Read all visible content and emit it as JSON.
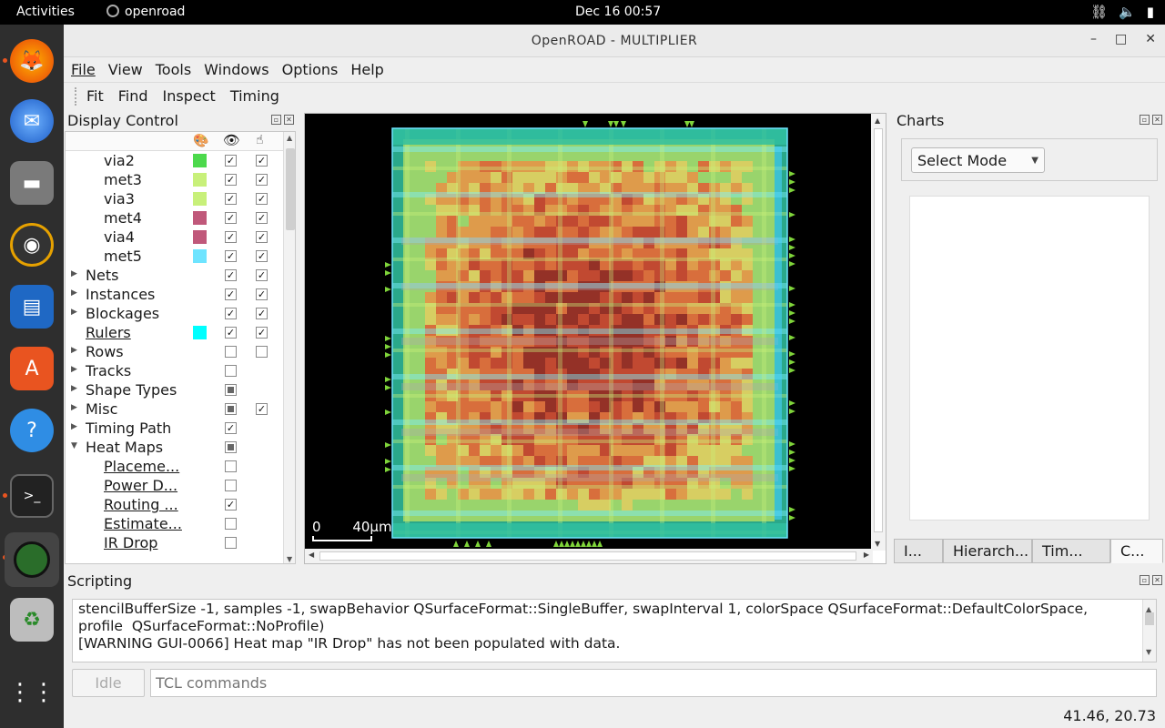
{
  "topbar": {
    "activities": "Activities",
    "app_name": "openroad",
    "clock": "Dec 16  00:57"
  },
  "window": {
    "title": "OpenROAD - MULTIPLIER",
    "minimize": "–",
    "maximize": "□",
    "close": "✕"
  },
  "menu": [
    "File",
    "View",
    "Tools",
    "Windows",
    "Options",
    "Help"
  ],
  "toolbar": [
    "Fit",
    "Find",
    "Inspect",
    "Timing"
  ],
  "display_control": {
    "title": "Display Control",
    "rows": [
      {
        "label": "via2",
        "indent": 2,
        "swatch": "#4cd94c",
        "vis": "checked",
        "sel": "checked"
      },
      {
        "label": "met3",
        "indent": 2,
        "swatch": "#c8f07a",
        "vis": "checked",
        "sel": "checked"
      },
      {
        "label": "via3",
        "indent": 2,
        "swatch": "#c8f07a",
        "vis": "checked",
        "sel": "checked"
      },
      {
        "label": "met4",
        "indent": 2,
        "swatch": "#c0587a",
        "vis": "checked",
        "sel": "checked"
      },
      {
        "label": "via4",
        "indent": 2,
        "swatch": "#c0587a",
        "vis": "checked",
        "sel": "checked"
      },
      {
        "label": "met5",
        "indent": 2,
        "swatch": "#6ee4ff",
        "vis": "checked",
        "sel": "checked"
      },
      {
        "label": "Nets",
        "indent": 1,
        "arrow": "right",
        "vis": "checked",
        "sel": "checked"
      },
      {
        "label": "Instances",
        "indent": 1,
        "arrow": "right",
        "vis": "checked",
        "sel": "checked"
      },
      {
        "label": "Blockages",
        "indent": 1,
        "arrow": "right",
        "vis": "checked",
        "sel": "checked"
      },
      {
        "label": "Rulers",
        "indent": 1,
        "link": true,
        "swatch": "#00ffff",
        "vis": "checked",
        "sel": "checked"
      },
      {
        "label": "Rows",
        "indent": 1,
        "arrow": "right",
        "vis": "empty",
        "sel": "empty"
      },
      {
        "label": "Tracks",
        "indent": 1,
        "arrow": "right",
        "vis": "empty"
      },
      {
        "label": "Shape Types",
        "indent": 1,
        "arrow": "right",
        "vis": "partial"
      },
      {
        "label": "Misc",
        "indent": 1,
        "arrow": "right",
        "vis": "partial",
        "sel": "checked"
      },
      {
        "label": "Timing Path",
        "indent": 1,
        "arrow": "right",
        "vis": "checked"
      },
      {
        "label": "Heat Maps",
        "indent": 1,
        "arrow": "down",
        "vis": "partial"
      },
      {
        "label": "Placeme...",
        "indent": 2,
        "link": true,
        "vis": "empty"
      },
      {
        "label": "Power D...",
        "indent": 2,
        "link": true,
        "vis": "empty"
      },
      {
        "label": "Routing ...",
        "indent": 2,
        "link": true,
        "vis": "checked"
      },
      {
        "label": "Estimate...",
        "indent": 2,
        "link": true,
        "vis": "empty"
      },
      {
        "label": "IR Drop",
        "indent": 2,
        "link": true,
        "vis": "empty"
      }
    ]
  },
  "viewer": {
    "scale_start": "0",
    "scale_end": "40μm"
  },
  "charts": {
    "title": "Charts",
    "mode": "Select Mode",
    "tabs": [
      "I...",
      "Hierarch...",
      "Tim...",
      "C..."
    ],
    "active_tab": 3
  },
  "scripting": {
    "title": "Scripting",
    "lines": [
      "stencilBufferSize -1, samples -1, swapBehavior QSurfaceFormat::SingleBuffer, swapInterval 1, colorSpace QSurfaceFormat::DefaultColorSpace,",
      "profile  QSurfaceFormat::NoProfile)",
      "[WARNING GUI-0066] Heat map \"IR Drop\" has not been populated with data."
    ],
    "idle": "Idle",
    "placeholder": "TCL commands"
  },
  "status": {
    "coords": "41.46, 20.73"
  }
}
